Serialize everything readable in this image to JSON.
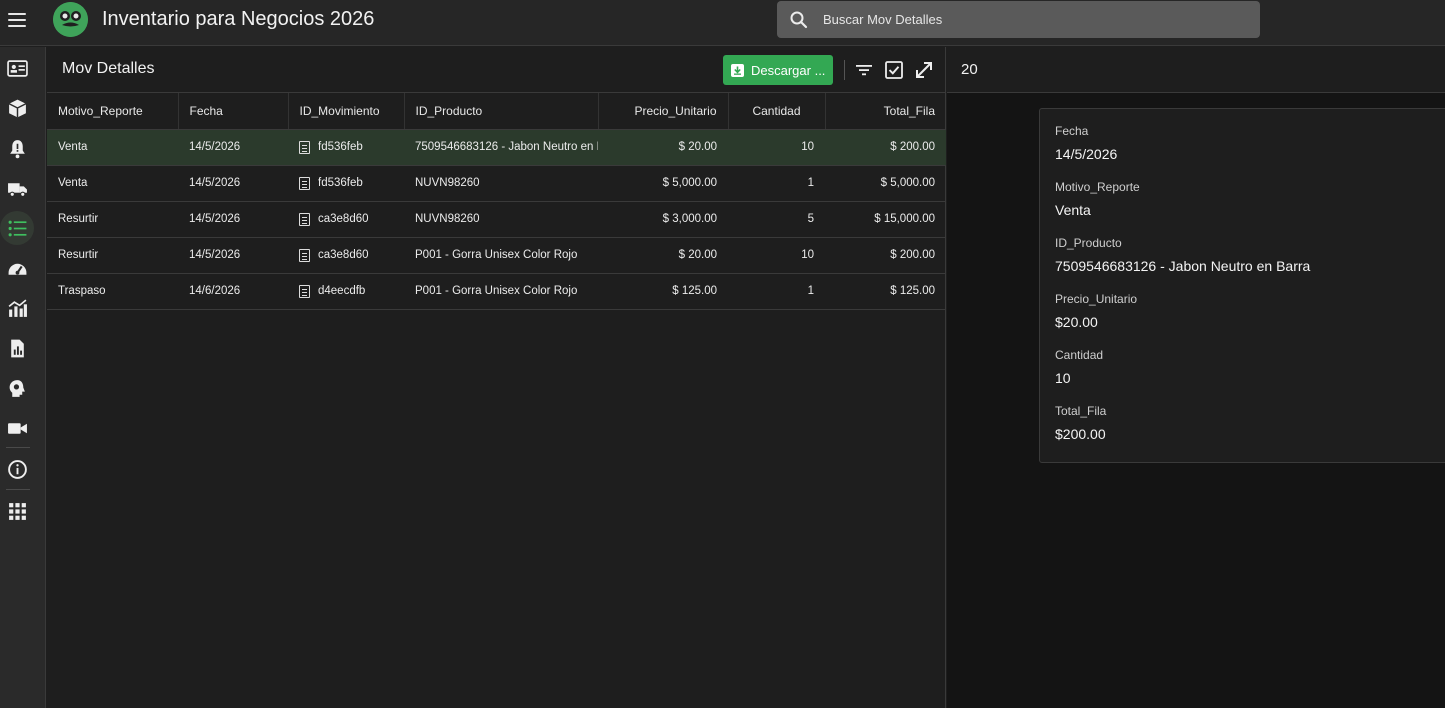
{
  "app": {
    "title": "Inventario para Negocios 2026"
  },
  "search": {
    "placeholder": "Buscar Mov Detalles"
  },
  "nav": {
    "items": [
      {
        "icon": "contact-card-icon"
      },
      {
        "icon": "box-icon"
      },
      {
        "icon": "bell-alert-icon"
      },
      {
        "icon": "truck-icon"
      },
      {
        "icon": "list-icon",
        "active": true
      },
      {
        "icon": "speedometer-icon"
      },
      {
        "icon": "chart-icon"
      },
      {
        "icon": "report-icon"
      },
      {
        "icon": "head-idea-icon"
      },
      {
        "icon": "video-icon"
      },
      {
        "icon": "info-icon"
      },
      {
        "icon": "apps-grid-icon"
      }
    ]
  },
  "panel": {
    "title": "Mov Detalles",
    "download_label": "Descargar ..."
  },
  "table": {
    "columns": [
      "Motivo_Reporte",
      "Fecha",
      "ID_Movimiento",
      "ID_Producto",
      "Precio_Unitario",
      "Cantidad",
      "Total_Fila"
    ],
    "rows": [
      [
        "Venta",
        "14/5/2026",
        "fd536feb",
        "7509546683126 - Jabon Neutro en Barra",
        "$ 20.00",
        "10",
        "$ 200.00"
      ],
      [
        "Venta",
        "14/5/2026",
        "fd536feb",
        "NUVN98260",
        "$ 5,000.00",
        "1",
        "$ 5,000.00"
      ],
      [
        "Resurtir",
        "14/5/2026",
        "ca3e8d60",
        "NUVN98260",
        "$ 3,000.00",
        "5",
        "$ 15,000.00"
      ],
      [
        "Resurtir",
        "14/5/2026",
        "ca3e8d60",
        "P001 - Gorra Unisex Color Rojo",
        "$ 20.00",
        "10",
        "$ 200.00"
      ],
      [
        "Traspaso",
        "14/6/2026",
        "d4eecdfb",
        "P001 - Gorra Unisex Color Rojo",
        "$ 125.00",
        "1",
        "$ 125.00"
      ]
    ]
  },
  "detail": {
    "header": "20",
    "fields": [
      {
        "label": "Fecha",
        "value": "14/5/2026"
      },
      {
        "label": "Motivo_Reporte",
        "value": "Venta"
      },
      {
        "label": "ID_Producto",
        "value": "7509546683126 - Jabon Neutro en Barra"
      },
      {
        "label": "Precio_Unitario",
        "value": "$20.00"
      },
      {
        "label": "Cantidad",
        "value": "10"
      },
      {
        "label": "Total_Fila",
        "value": "$200.00"
      }
    ]
  },
  "colors": {
    "accent": "#33a853",
    "selected_row": "#2b3a2c",
    "background": "#1e1e1e"
  }
}
